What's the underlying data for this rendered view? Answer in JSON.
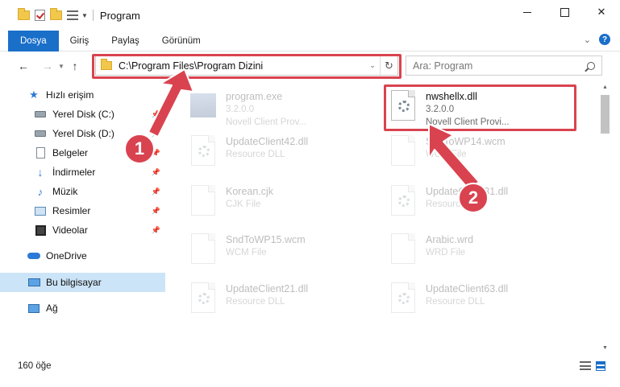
{
  "window": {
    "title": "Program"
  },
  "ribbon": {
    "tabs": [
      "Dosya",
      "Giriş",
      "Paylaş",
      "Görünüm"
    ],
    "help": "?"
  },
  "address": {
    "path": "C:\\Program Files\\Program Dizini"
  },
  "search": {
    "placeholder": "Ara: Program"
  },
  "sidebar": {
    "items": [
      {
        "label": "Hızlı erişim",
        "icon": "star-icon"
      },
      {
        "label": "Yerel Disk (C:)",
        "icon": "drive-icon",
        "pinned": true
      },
      {
        "label": "Yerel Disk (D:)",
        "icon": "drive-icon",
        "pinned": true
      },
      {
        "label": "Belgeler",
        "icon": "documents-icon",
        "pinned": true
      },
      {
        "label": "İndirmeler",
        "icon": "downloads-icon",
        "pinned": true
      },
      {
        "label": "Müzik",
        "icon": "music-icon",
        "pinned": true
      },
      {
        "label": "Resimler",
        "icon": "pictures-icon",
        "pinned": true
      },
      {
        "label": "Videolar",
        "icon": "videos-icon",
        "pinned": true
      },
      {
        "label": "OneDrive",
        "icon": "onedrive-icon"
      },
      {
        "label": "Bu bilgisayar",
        "icon": "computer-icon",
        "selected": true
      },
      {
        "label": "Ağ",
        "icon": "network-icon"
      }
    ]
  },
  "files": [
    {
      "name": "program.exe",
      "line1": "3.2.0.0",
      "line2": "Novell Client Prov...",
      "faded": true,
      "icon": "exe-icon"
    },
    {
      "name": "nwshellx.dll",
      "line1": "3.2.0.0",
      "line2": "Novell Client Provi...",
      "faded": false,
      "icon": "dll-icon"
    },
    {
      "name": "UpdateClient42.dll",
      "line1": "Resource DLL",
      "line2": "",
      "faded": true,
      "icon": "dll-icon"
    },
    {
      "name": "SndToWP14.wcm",
      "line1": "WCM File",
      "line2": "",
      "faded": true,
      "icon": "file-icon"
    },
    {
      "name": "Korean.cjk",
      "line1": "CJK File",
      "line2": "",
      "faded": true,
      "icon": "file-icon"
    },
    {
      "name": "UpdateClient31.dll",
      "line1": "Resource DLL",
      "line2": "",
      "faded": true,
      "icon": "dll-icon"
    },
    {
      "name": "SndToWP15.wcm",
      "line1": "WCM File",
      "line2": "",
      "faded": true,
      "icon": "file-icon"
    },
    {
      "name": "Arabic.wrd",
      "line1": "WRD File",
      "line2": "",
      "faded": true,
      "icon": "file-icon"
    },
    {
      "name": "UpdateClient21.dll",
      "line1": "Resource DLL",
      "line2": "",
      "faded": true,
      "icon": "dll-icon"
    },
    {
      "name": "UpdateClient63.dll",
      "line1": "Resource DLL",
      "line2": "",
      "faded": true,
      "icon": "dll-icon"
    }
  ],
  "status": {
    "count": "160 öğe"
  },
  "annotations": {
    "badge1": "1",
    "badge2": "2",
    "color": "#d9434f"
  }
}
